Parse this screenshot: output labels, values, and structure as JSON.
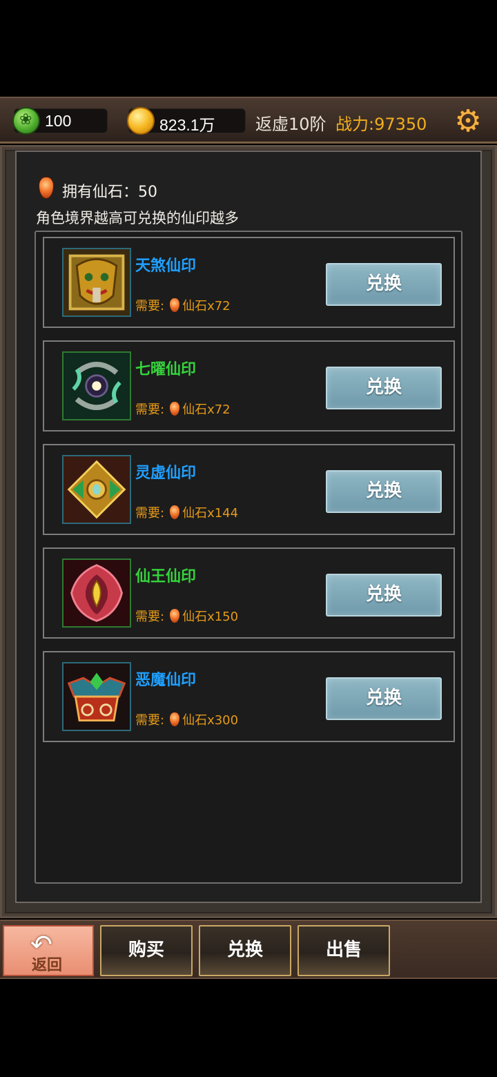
{
  "topbar": {
    "jade_icon": "jade-coin-icon",
    "jade_value": "100",
    "gold_icon": "gold-coin-icon",
    "gold_value": "823.1万",
    "realm": "返虚10阶",
    "power": "战力:97350",
    "settings_icon": "gear-icon"
  },
  "panel": {
    "owned_label": "拥有仙石：50",
    "hint": "角色境界越高可兑换的仙印越多"
  },
  "items": [
    {
      "name": "天煞仙印",
      "name_color": "#1fa0ff",
      "req_prefix": "需要:",
      "req_text": "仙石x72",
      "button": "兑换"
    },
    {
      "name": "七曜仙印",
      "name_color": "#35d43c",
      "req_prefix": "需要:",
      "req_text": "仙石x72",
      "button": "兑换"
    },
    {
      "name": "灵虚仙印",
      "name_color": "#1fa0ff",
      "req_prefix": "需要:",
      "req_text": "仙石x144",
      "button": "兑换"
    },
    {
      "name": "仙王仙印",
      "name_color": "#35d43c",
      "req_prefix": "需要:",
      "req_text": "仙石x150",
      "button": "兑换"
    },
    {
      "name": "恶魔仙印",
      "name_color": "#1fa0ff",
      "req_prefix": "需要:",
      "req_text": "仙石x300",
      "button": "兑换"
    }
  ],
  "bottombar": {
    "back_label": "返回",
    "tabs": [
      "购买",
      "兑换",
      "出售"
    ]
  }
}
